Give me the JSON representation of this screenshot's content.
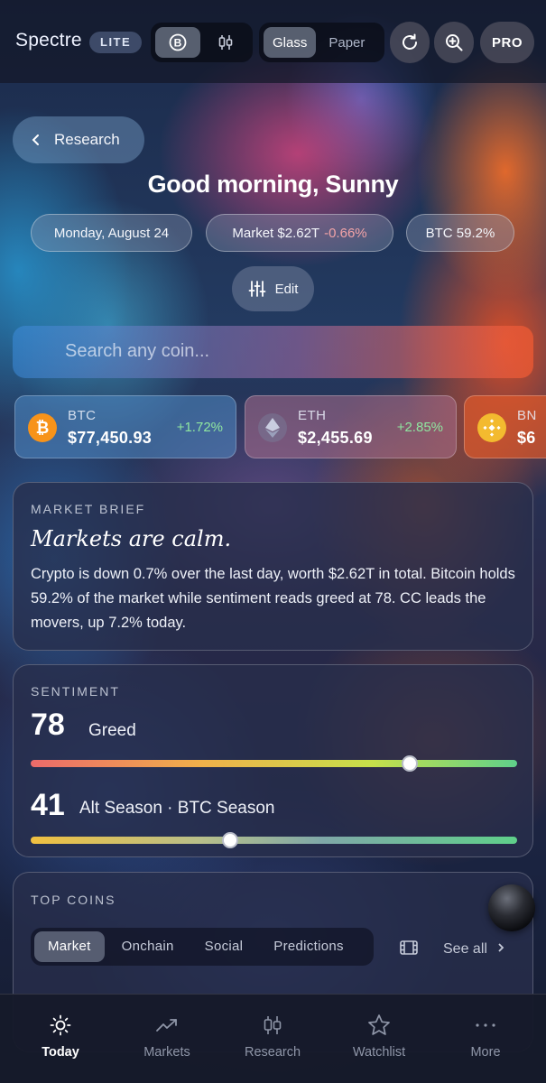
{
  "header": {
    "brand": "Spectre",
    "badge": "LITE",
    "view_toggle": [
      {
        "icon": "bitcoin-icon",
        "active": true
      },
      {
        "icon": "candlestick-icon",
        "active": false
      }
    ],
    "theme_toggle": [
      {
        "label": "Glass",
        "active": true
      },
      {
        "label": "Paper",
        "active": false
      }
    ],
    "refresh_icon": "refresh-icon",
    "zoom_icon": "zoom-in-icon",
    "pro_label": "PRO"
  },
  "back": {
    "label": "Research",
    "icon": "chevron-left-icon"
  },
  "greeting": "Good morning, Sunny",
  "chips": {
    "date": "Monday, August 24",
    "market_label": "Market $2.62T",
    "market_change": "-0.66%",
    "btc_dominance": "BTC 59.2%"
  },
  "edit_label": "Edit",
  "search": {
    "placeholder": "Search any coin..."
  },
  "tickers": [
    {
      "symbol": "BTC",
      "price": "$77,450.93",
      "change": "+1.72%",
      "icon": "bitcoin-icon",
      "color": "#f7931a"
    },
    {
      "symbol": "ETH",
      "price": "$2,455.69",
      "change": "+2.85%",
      "icon": "ethereum-icon",
      "color": "#8a92b2"
    },
    {
      "symbol": "BN",
      "price": "$6",
      "icon": "bnb-icon",
      "color": "#f3ba2f"
    }
  ],
  "brief": {
    "label": "MARKET BRIEF",
    "headline": "Markets are calm.",
    "body": "Crypto is down 0.7% over the last day, worth $2.62T in total. Bitcoin holds 59.2% of the market while sentiment reads greed at 78. CC leads the movers, up 7.2% today."
  },
  "sentiment": {
    "label": "SENTIMENT",
    "fear_greed": {
      "value": "78",
      "label": "Greed",
      "level": 0.78
    },
    "alt_season": {
      "value": "41",
      "label": "Alt Season · BTC Season",
      "level": 0.41
    }
  },
  "top_coins": {
    "label": "TOP COINS",
    "tabs": [
      {
        "label": "Market",
        "active": true
      },
      {
        "label": "Onchain",
        "active": false
      },
      {
        "label": "Social",
        "active": false
      },
      {
        "label": "Predictions",
        "active": false
      }
    ],
    "see_all": "See all"
  },
  "nav": [
    {
      "label": "Today",
      "icon": "sun-icon",
      "active": true
    },
    {
      "label": "Markets",
      "icon": "trending-up-icon",
      "active": false
    },
    {
      "label": "Research",
      "icon": "candlestick-icon",
      "active": false
    },
    {
      "label": "Watchlist",
      "icon": "star-icon",
      "active": false
    },
    {
      "label": "More",
      "icon": "more-dots-icon",
      "active": false
    }
  ],
  "colors": {
    "positive": "#8fe6a0",
    "negative": "#f2a3a7"
  }
}
